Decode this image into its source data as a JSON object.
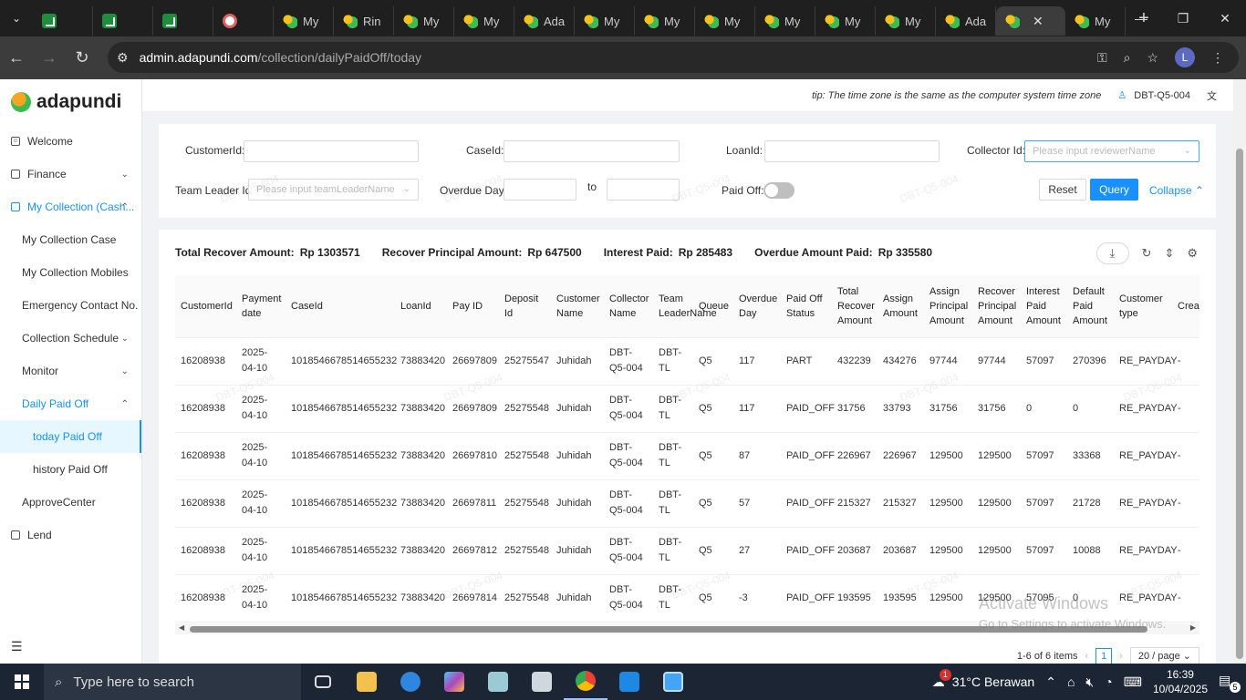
{
  "browser": {
    "tabs": [
      {
        "title": "",
        "icon": "sheets"
      },
      {
        "title": "",
        "icon": "sheets"
      },
      {
        "title": "",
        "icon": "sheets"
      },
      {
        "title": "",
        "icon": "circle"
      },
      {
        "title": "My",
        "icon": "adapundi"
      },
      {
        "title": "Rin",
        "icon": "adapundi"
      },
      {
        "title": "My",
        "icon": "adapundi"
      },
      {
        "title": "My",
        "icon": "adapundi"
      },
      {
        "title": "Ada",
        "icon": "adapundi"
      },
      {
        "title": "My",
        "icon": "adapundi"
      },
      {
        "title": "My",
        "icon": "adapundi"
      },
      {
        "title": "My",
        "icon": "adapundi"
      },
      {
        "title": "My",
        "icon": "adapundi"
      },
      {
        "title": "My",
        "icon": "adapundi"
      },
      {
        "title": "My",
        "icon": "adapundi"
      },
      {
        "title": "Ada",
        "icon": "adapundi"
      },
      {
        "title": "",
        "icon": "adapundi",
        "active": true
      },
      {
        "title": "My",
        "icon": "adapundi"
      }
    ],
    "url_host": "admin.adapundi.com",
    "url_path": "/collection/dailyPaidOff/today",
    "profile_initial": "L"
  },
  "app": {
    "logo_text": "adapundi",
    "tip": "tip: The time zone is the same as the computer system time zone",
    "user": "DBT-Q5-004"
  },
  "sidebar": {
    "items": [
      {
        "label": "Welcome"
      },
      {
        "label": "Finance"
      },
      {
        "label": "My Collection (Cash..."
      },
      {
        "label": "My Collection Case"
      },
      {
        "label": "My Collection Mobiles"
      },
      {
        "label": "Emergency Contact No."
      },
      {
        "label": "Collection Schedule"
      },
      {
        "label": "Monitor"
      },
      {
        "label": "Daily Paid Off"
      },
      {
        "label": "today Paid Off"
      },
      {
        "label": "history Paid Off"
      },
      {
        "label": "ApproveCenter"
      },
      {
        "label": "Lend"
      }
    ]
  },
  "filters": {
    "customer_id_label": "CustomerId:",
    "case_id_label": "CaseId:",
    "loan_id_label": "LoanId:",
    "collector_id_label": "Collector Id:",
    "collector_placeholder": "Please input reviewerName",
    "team_leader_label": "Team Leader Id:",
    "team_leader_placeholder": "Please input teamLeaderName",
    "overdue_day_label": "Overdue Day:",
    "to_label": "to",
    "paid_off_label": "Paid Off:",
    "reset_label": "Reset",
    "query_label": "Query",
    "collapse_label": "Collapse"
  },
  "summary": {
    "total_recover_label": "Total Recover Amount:",
    "total_recover_value": "Rp 1303571",
    "recover_principal_label": "Recover Principal Amount:",
    "recover_principal_value": "Rp 647500",
    "interest_paid_label": "Interest Paid:",
    "interest_paid_value": "Rp 285483",
    "overdue_paid_label": "Overdue Amount Paid:",
    "overdue_paid_value": "Rp 335580"
  },
  "table": {
    "columns": [
      "CustomerId",
      "Payment date",
      "CaseId",
      "LoanId",
      "Pay ID",
      "Deposit Id",
      "Customer Name",
      "Collector Name",
      "Team LeaderName",
      "Queue",
      "Overdue Day",
      "Paid Off Status",
      "Total Recover Amount",
      "Assign Amount",
      "Assign Principal Amount",
      "Recover Principal Amount",
      "Interest Paid Amount",
      "Default Paid Amount",
      "Customer type",
      "Crea"
    ],
    "rows": [
      [
        "16208938",
        "2025-04-10",
        "1018546678514655232",
        "73883420",
        "26697809",
        "25275547",
        "Juhidah",
        "DBT-Q5-004",
        "DBT-TL",
        "Q5",
        "117",
        "PART",
        "432239",
        "434276",
        "97744",
        "97744",
        "57097",
        "270396",
        "RE_PAYDAY",
        "-"
      ],
      [
        "16208938",
        "2025-04-10",
        "1018546678514655232",
        "73883420",
        "26697809",
        "25275548",
        "Juhidah",
        "DBT-Q5-004",
        "DBT-TL",
        "Q5",
        "117",
        "PAID_OFF",
        "31756",
        "33793",
        "31756",
        "31756",
        "0",
        "0",
        "RE_PAYDAY",
        "-"
      ],
      [
        "16208938",
        "2025-04-10",
        "1018546678514655232",
        "73883420",
        "26697810",
        "25275548",
        "Juhidah",
        "DBT-Q5-004",
        "DBT-TL",
        "Q5",
        "87",
        "PAID_OFF",
        "226967",
        "226967",
        "129500",
        "129500",
        "57097",
        "33368",
        "RE_PAYDAY",
        "-"
      ],
      [
        "16208938",
        "2025-04-10",
        "1018546678514655232",
        "73883420",
        "26697811",
        "25275548",
        "Juhidah",
        "DBT-Q5-004",
        "DBT-TL",
        "Q5",
        "57",
        "PAID_OFF",
        "215327",
        "215327",
        "129500",
        "129500",
        "57097",
        "21728",
        "RE_PAYDAY",
        "-"
      ],
      [
        "16208938",
        "2025-04-10",
        "1018546678514655232",
        "73883420",
        "26697812",
        "25275548",
        "Juhidah",
        "DBT-Q5-004",
        "DBT-TL",
        "Q5",
        "27",
        "PAID_OFF",
        "203687",
        "203687",
        "129500",
        "129500",
        "57097",
        "10088",
        "RE_PAYDAY",
        "-"
      ],
      [
        "16208938",
        "2025-04-10",
        "1018546678514655232",
        "73883420",
        "26697814",
        "25275548",
        "Juhidah",
        "DBT-Q5-004",
        "DBT-TL",
        "Q5",
        "-3",
        "PAID_OFF",
        "193595",
        "193595",
        "129500",
        "129500",
        "57095",
        "0",
        "RE_PAYDAY",
        "-"
      ]
    ]
  },
  "pagination": {
    "total_text": "1-6 of 6 items",
    "current_page": "1",
    "page_size": "20 / page"
  },
  "watermark_text": "DBT-Q5-004",
  "windows_notice": {
    "line1": "Activate Windows",
    "line2": "Go to Settings to activate Windows."
  },
  "taskbar": {
    "search_placeholder": "Type here to search",
    "weather": "31°C  Berawan",
    "time": "16:39",
    "date": "10/04/2025",
    "notification_count": "1",
    "action_center_count": "5"
  }
}
